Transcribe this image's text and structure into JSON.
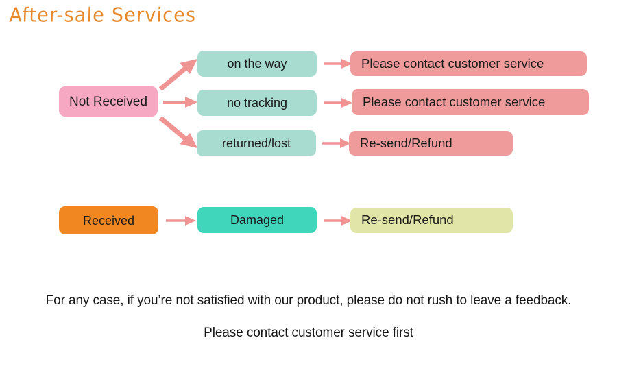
{
  "page": {
    "title": "After-sale Services",
    "title_color": "#e8892c",
    "background": "#ffffff"
  },
  "palette": {
    "pink": "#f6a8c3",
    "mint": "#a9dcd0",
    "salmon": "#ef9b9b",
    "orange": "#f08720",
    "teal": "#3fd6bc",
    "yellow": "#e2e5a8",
    "arrow": "#ef9393",
    "text": "#1b1b1b"
  },
  "flow": {
    "branches": [
      {
        "source": {
          "label": "Not Received",
          "color": "#f6a8c3",
          "name": "node-not-received"
        },
        "rows": [
          {
            "connector": "arrow-up-right",
            "middle": {
              "label": "on the way",
              "color": "#a9dcd0",
              "name": "node-on-the-way"
            },
            "connector2": "arrow-right",
            "outcome": {
              "label": "Please contact customer service",
              "color": "#ef9b9b",
              "name": "node-outcome-contact-service-1"
            }
          },
          {
            "connector": "arrow-right",
            "middle": {
              "label": "no tracking",
              "color": "#a9dcd0",
              "name": "node-no-tracking"
            },
            "connector2": "arrow-right",
            "outcome": {
              "label": "Please contact customer service",
              "color": "#ef9b9b",
              "name": "node-outcome-contact-service-2"
            }
          },
          {
            "connector": "arrow-down-right",
            "middle": {
              "label": "returned/lost",
              "color": "#a9dcd0",
              "name": "node-returned-lost"
            },
            "connector2": "arrow-right",
            "outcome": {
              "label": "Re-send/Refund",
              "color": "#ef9b9b",
              "name": "node-outcome-resend-refund-1"
            }
          }
        ]
      },
      {
        "source": {
          "label": "Received",
          "color": "#f08720",
          "name": "node-received"
        },
        "rows": [
          {
            "connector": "arrow-right",
            "middle": {
              "label": "Damaged",
              "color": "#3fd6bc",
              "name": "node-damaged"
            },
            "connector2": "arrow-right",
            "outcome": {
              "label": "Re-send/Refund",
              "color": "#e2e5a8",
              "name": "node-outcome-resend-refund-2"
            }
          }
        ]
      }
    ]
  },
  "footer": {
    "line1": "For any case, if you’re not satisfied with our product, please do not rush to leave a feedback.",
    "line2": "Please contact customer service first"
  }
}
